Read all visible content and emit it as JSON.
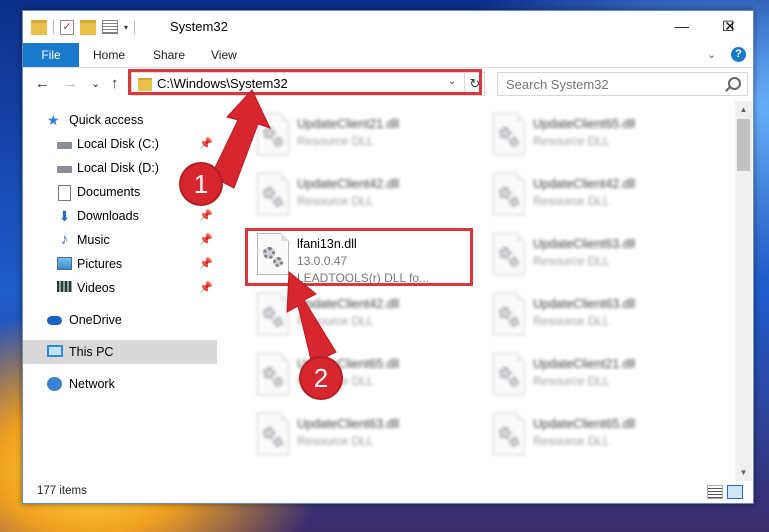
{
  "window": {
    "title": "System32",
    "minimize": "—",
    "maximize": "☐",
    "close": "✕"
  },
  "ribbon": {
    "tabs": [
      "File",
      "Home",
      "Share",
      "View"
    ],
    "expand": "⌄",
    "help": "?"
  },
  "nav": {
    "back": "←",
    "forward": "→",
    "recent": "⌄",
    "up": "↑",
    "address": "C:\\Windows\\System32",
    "address_dropdown": "⌄",
    "refresh": "↻",
    "search_placeholder": "Search System32"
  },
  "sidebar": {
    "items": [
      {
        "label": "Quick access",
        "icon": "star-icon",
        "pinned": false
      },
      {
        "label": "Local Disk (C:)",
        "icon": "disk-icon",
        "pinned": true
      },
      {
        "label": "Local Disk (D:)",
        "icon": "disk-icon",
        "pinned": false
      },
      {
        "label": "Documents",
        "icon": "documents-icon",
        "pinned": true
      },
      {
        "label": "Downloads",
        "icon": "download-icon",
        "pinned": true
      },
      {
        "label": "Music",
        "icon": "music-icon",
        "pinned": true
      },
      {
        "label": "Pictures",
        "icon": "pictures-icon",
        "pinned": true
      },
      {
        "label": "Videos",
        "icon": "videos-icon",
        "pinned": true
      },
      {
        "label": "OneDrive",
        "icon": "onedrive-icon",
        "pinned": false
      },
      {
        "label": "This PC",
        "icon": "this-pc-icon",
        "pinned": false,
        "selected": true
      },
      {
        "label": "Network",
        "icon": "network-icon",
        "pinned": false
      }
    ],
    "pin_glyph": "📌"
  },
  "files": {
    "left": [
      {
        "name": "UpdateClient21.dll",
        "type": "Resource DLL"
      },
      {
        "name": "UpdateClient42.dll",
        "type": "Resource DLL"
      },
      {
        "name": "lfani13n.dll",
        "version": "13.0.0.47",
        "description": "LEADTOOLS(r) DLL fo..."
      },
      {
        "name": "UpdateClient42.dll",
        "type": "Resource DLL"
      },
      {
        "name": "UpdateClient65.dll",
        "type": "Resource DLL"
      },
      {
        "name": "UpdateClient63.dll",
        "type": "Resource DLL"
      }
    ],
    "right": [
      {
        "name": "UpdateClient65.dll",
        "type": "Resource DLL"
      },
      {
        "name": "UpdateClient42.dll",
        "type": "Resource DLL"
      },
      {
        "name": "UpdateClient63.dll",
        "type": "Resource DLL"
      },
      {
        "name": "UpdateClient63.dll",
        "type": "Resource DLL"
      },
      {
        "name": "UpdateClient21.dll",
        "type": "Resource DLL"
      },
      {
        "name": "UpdateClient65.dll",
        "type": "Resource DLL"
      }
    ]
  },
  "status": {
    "item_count": "177 items"
  },
  "annotations": {
    "step1": "1",
    "step2": "2",
    "highlight_color": "#d9363e"
  },
  "colors": {
    "accent": "#1979ca",
    "selection": "#d9d9d9"
  }
}
